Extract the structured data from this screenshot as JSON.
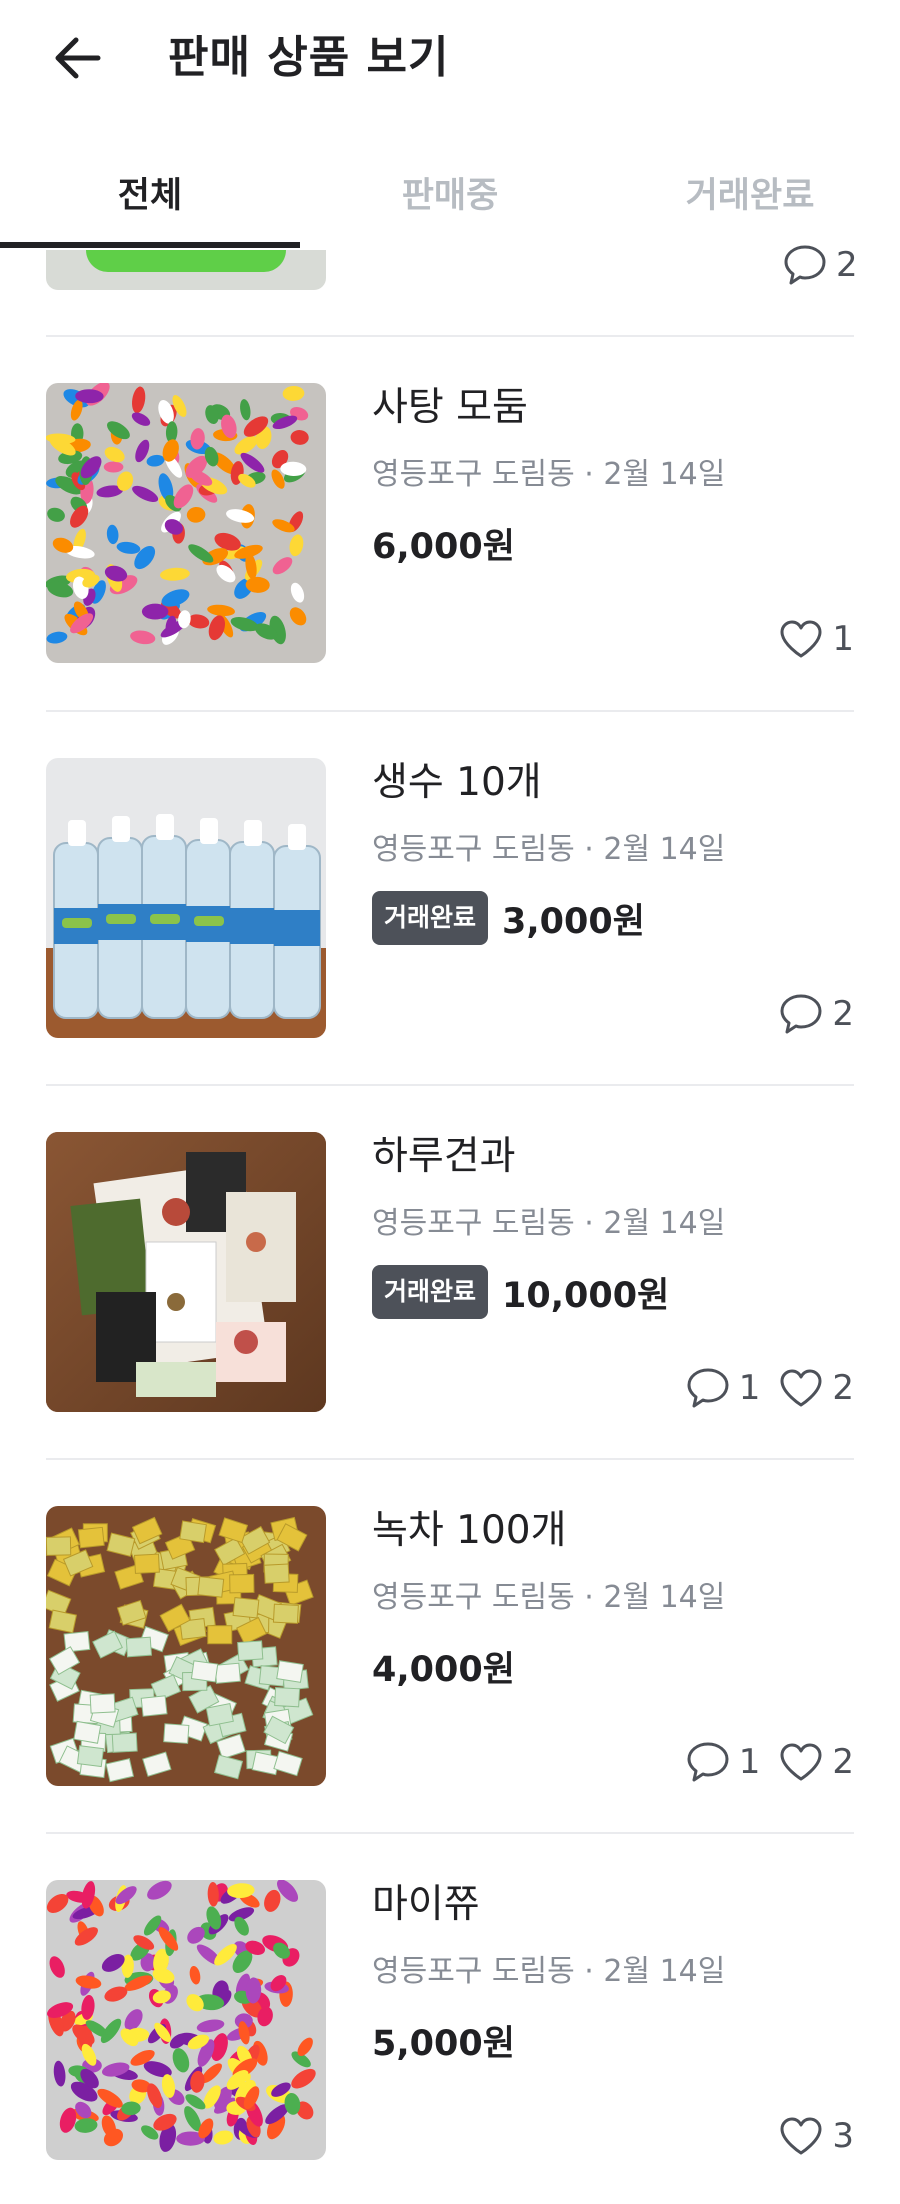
{
  "header": {
    "title": "판매 상품 보기"
  },
  "tabs": [
    {
      "label": "전체"
    },
    {
      "label": "판매중"
    },
    {
      "label": "거래완료"
    }
  ],
  "partial_item": {
    "comments": "2"
  },
  "items": [
    {
      "title": "사탕 모둠",
      "location": "영등포구 도림동",
      "date": "2월 14일",
      "badge": "",
      "price": "6,000원",
      "comments": "",
      "likes": "1",
      "thumb": "candy-assortment"
    },
    {
      "title": "생수 10개",
      "location": "영등포구 도림동",
      "date": "2월 14일",
      "badge": "거래완료",
      "price": "3,000원",
      "comments": "2",
      "likes": "",
      "thumb": "water-bottles"
    },
    {
      "title": "하루견과",
      "location": "영등포구 도림동",
      "date": "2월 14일",
      "badge": "거래완료",
      "price": "10,000원",
      "comments": "1",
      "likes": "2",
      "thumb": "nut-packs"
    },
    {
      "title": "녹차 100개",
      "location": "영등포구 도림동",
      "date": "2월 14일",
      "badge": "",
      "price": "4,000원",
      "comments": "1",
      "likes": "2",
      "thumb": "green-tea-bags"
    },
    {
      "title": "마이쮸",
      "location": "영등포구 도림동",
      "date": "2월 14일",
      "badge": "",
      "price": "5,000원",
      "comments": "",
      "likes": "3",
      "thumb": "chewy-candy"
    }
  ],
  "colors": {
    "text": "#212124",
    "muted": "#868b94",
    "tab_inactive": "#b7bcc2",
    "badge_bg": "#4d5159",
    "divider": "#eaebee"
  }
}
